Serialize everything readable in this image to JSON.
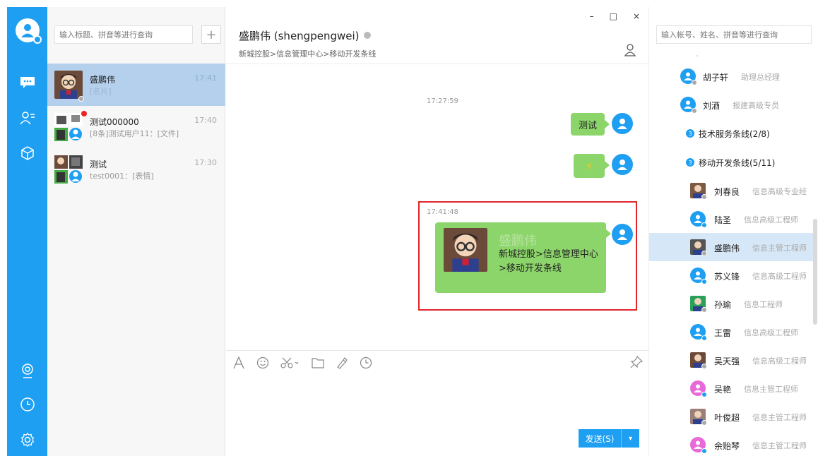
{
  "sessions": {
    "search_placeholder": "输入标题、拼音等进行查询",
    "add_label": "+",
    "items": [
      {
        "name": "盛鹏伟",
        "preview": "[名片]",
        "time": "17:41"
      },
      {
        "name": "测试000000",
        "preview": "[8条]测试用户11：[文件]",
        "time": "17:40"
      },
      {
        "name": "测试",
        "preview": "test0001：[表情]",
        "time": "17:30"
      }
    ]
  },
  "chat": {
    "window_controls": {
      "minimize": "–",
      "maximize": "□",
      "close": "×"
    },
    "title": "盛鹏伟 (shengpengwei)",
    "path": "新城控股>信息管理中心>移动开发条线",
    "timestamps": [
      "17:27:59",
      "17:41:48"
    ],
    "messages": [
      {
        "text": "测试"
      },
      {
        "text": "⚡"
      }
    ],
    "card": {
      "name": "盛鹏伟",
      "desc": "新城控股>信息管理中心>移动开发条线"
    },
    "send_label": "发送(S)",
    "send_dropdown": "▾"
  },
  "contacts": {
    "search_placeholder": "输入帐号、姓名、拼音等进行查询",
    "top_dash": "-",
    "rows": [
      {
        "name": "胡子轩",
        "title": "助理总经理",
        "avatar": "default"
      },
      {
        "name": "刘酒",
        "title": "报建高级专员",
        "avatar": "default"
      }
    ],
    "groups": [
      {
        "badge": "3",
        "name": "技术服务条线(2/8)"
      },
      {
        "badge": "3",
        "name": "移动开发条线(5/11)"
      }
    ],
    "members": [
      {
        "name": "刘春良",
        "title": "信息高级专业经",
        "avatar": "photo"
      },
      {
        "name": "陆圣",
        "title": "信息高级工程师",
        "avatar": "blue"
      },
      {
        "name": "盛鹏伟",
        "title": "信息主管工程师",
        "avatar": "photo"
      },
      {
        "name": "苏义锋",
        "title": "信息高级工程师",
        "avatar": "blue"
      },
      {
        "name": "孙瑜",
        "title": "信息工程师",
        "avatar": "photo"
      },
      {
        "name": "王雷",
        "title": "信息高级工程师",
        "avatar": "blue"
      },
      {
        "name": "吴天强",
        "title": "信息高级工程师",
        "avatar": "photo"
      },
      {
        "name": "吴艳",
        "title": "信息主管工程师",
        "avatar": "pink"
      },
      {
        "name": "叶俊超",
        "title": "信息主管工程师",
        "avatar": "photo"
      },
      {
        "name": "余贻琴",
        "title": "信息主管工程师",
        "avatar": "pink"
      }
    ]
  },
  "colors": {
    "accent": "#1e9ff2",
    "bubble": "#8cd56a",
    "highlight": "#e0242b",
    "active_row": "#b4d0ec"
  }
}
